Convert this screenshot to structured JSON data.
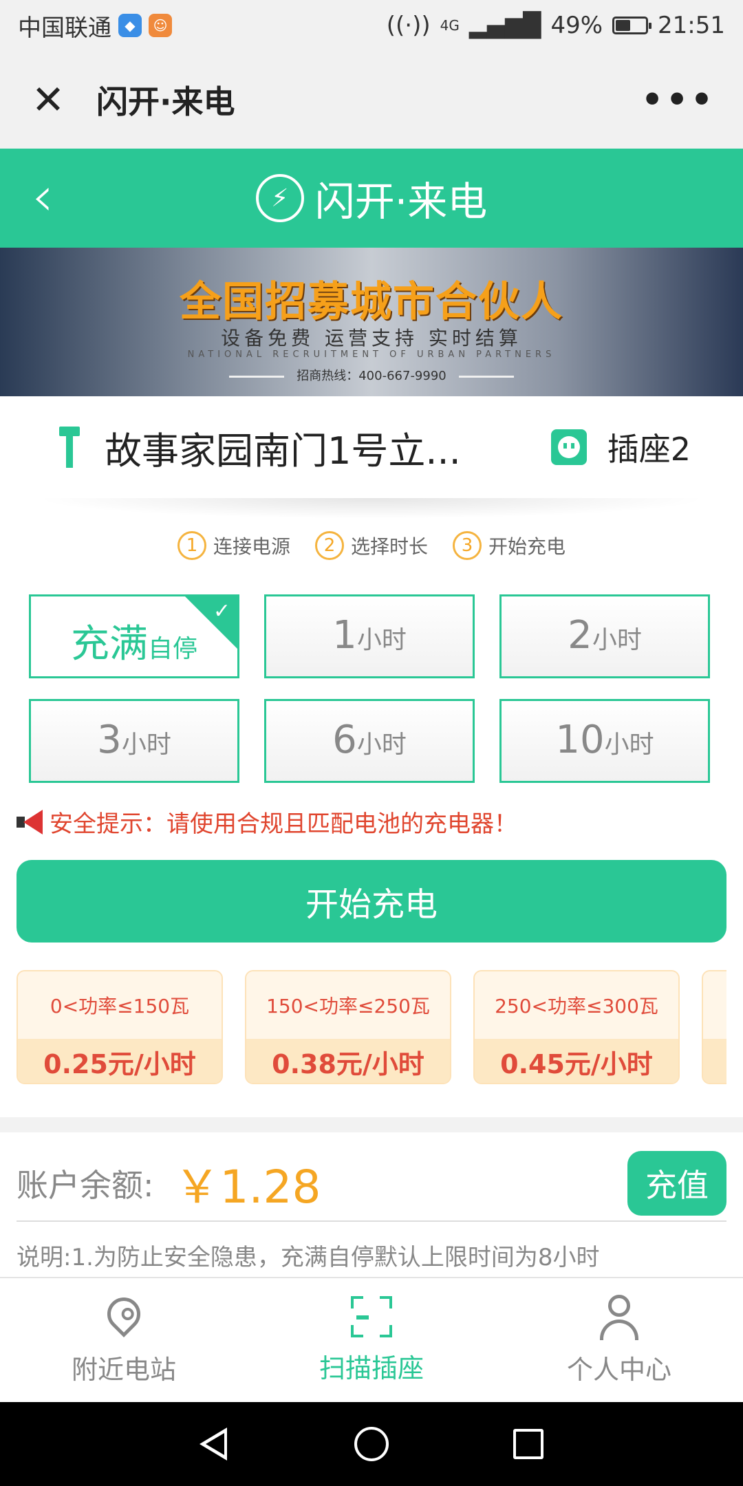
{
  "status_bar": {
    "carrier": "中国联通",
    "network": "4G",
    "battery": "49%",
    "battery_level": 0.49,
    "time": "21:51"
  },
  "webview": {
    "title": "闪开·来电",
    "close_icon": "close-icon",
    "more_icon": "more-icon"
  },
  "app_header": {
    "title": "闪开·来电"
  },
  "banner": {
    "headline": "全国招募城市合伙人",
    "subline": "设备免费 运营支持 实时结算",
    "english": "NATIONAL RECRUITMENT OF URBAN PARTNERS",
    "hotline": "招商热线：400-667-9990"
  },
  "station": {
    "name": "故事家园南门1号立...",
    "socket": "插座2"
  },
  "steps": [
    {
      "num": "1",
      "label": "连接电源"
    },
    {
      "num": "2",
      "label": "选择时长"
    },
    {
      "num": "3",
      "label": "开始充电"
    }
  ],
  "durations": [
    {
      "big": "充满",
      "small": "自停",
      "selected": true
    },
    {
      "big": "1",
      "small": "小时",
      "selected": false
    },
    {
      "big": "2",
      "small": "小时",
      "selected": false
    },
    {
      "big": "3",
      "small": "小时",
      "selected": false
    },
    {
      "big": "6",
      "small": "小时",
      "selected": false
    },
    {
      "big": "10",
      "small": "小时",
      "selected": false
    }
  ],
  "safety_tip": "安全提示：请使用合规且匹配电池的充电器！",
  "start_button": "开始充电",
  "prices": [
    {
      "range": "0<功率≤150瓦",
      "rate": "0.25元/小时"
    },
    {
      "range": "150<功率≤250瓦",
      "rate": "0.38元/小时"
    },
    {
      "range": "250<功率≤300瓦",
      "rate": "0.45元/小时"
    }
  ],
  "account": {
    "balance_label": "账户余额:",
    "balance_value": "￥1.28",
    "recharge": "充值",
    "note": "说明:1.为防止安全隐患，充满自停默认上限时间为8小时"
  },
  "bottom_nav": [
    {
      "label": "附近电站",
      "icon": "location-pin-icon",
      "active": false
    },
    {
      "label": "扫描插座",
      "icon": "scan-icon",
      "active": true
    },
    {
      "label": "个人中心",
      "icon": "user-icon",
      "active": false
    }
  ],
  "colors": {
    "brand_green": "#2ac795",
    "price_red": "#e04b3a",
    "balance_orange": "#f5a623",
    "step_orange": "#f5b440"
  }
}
